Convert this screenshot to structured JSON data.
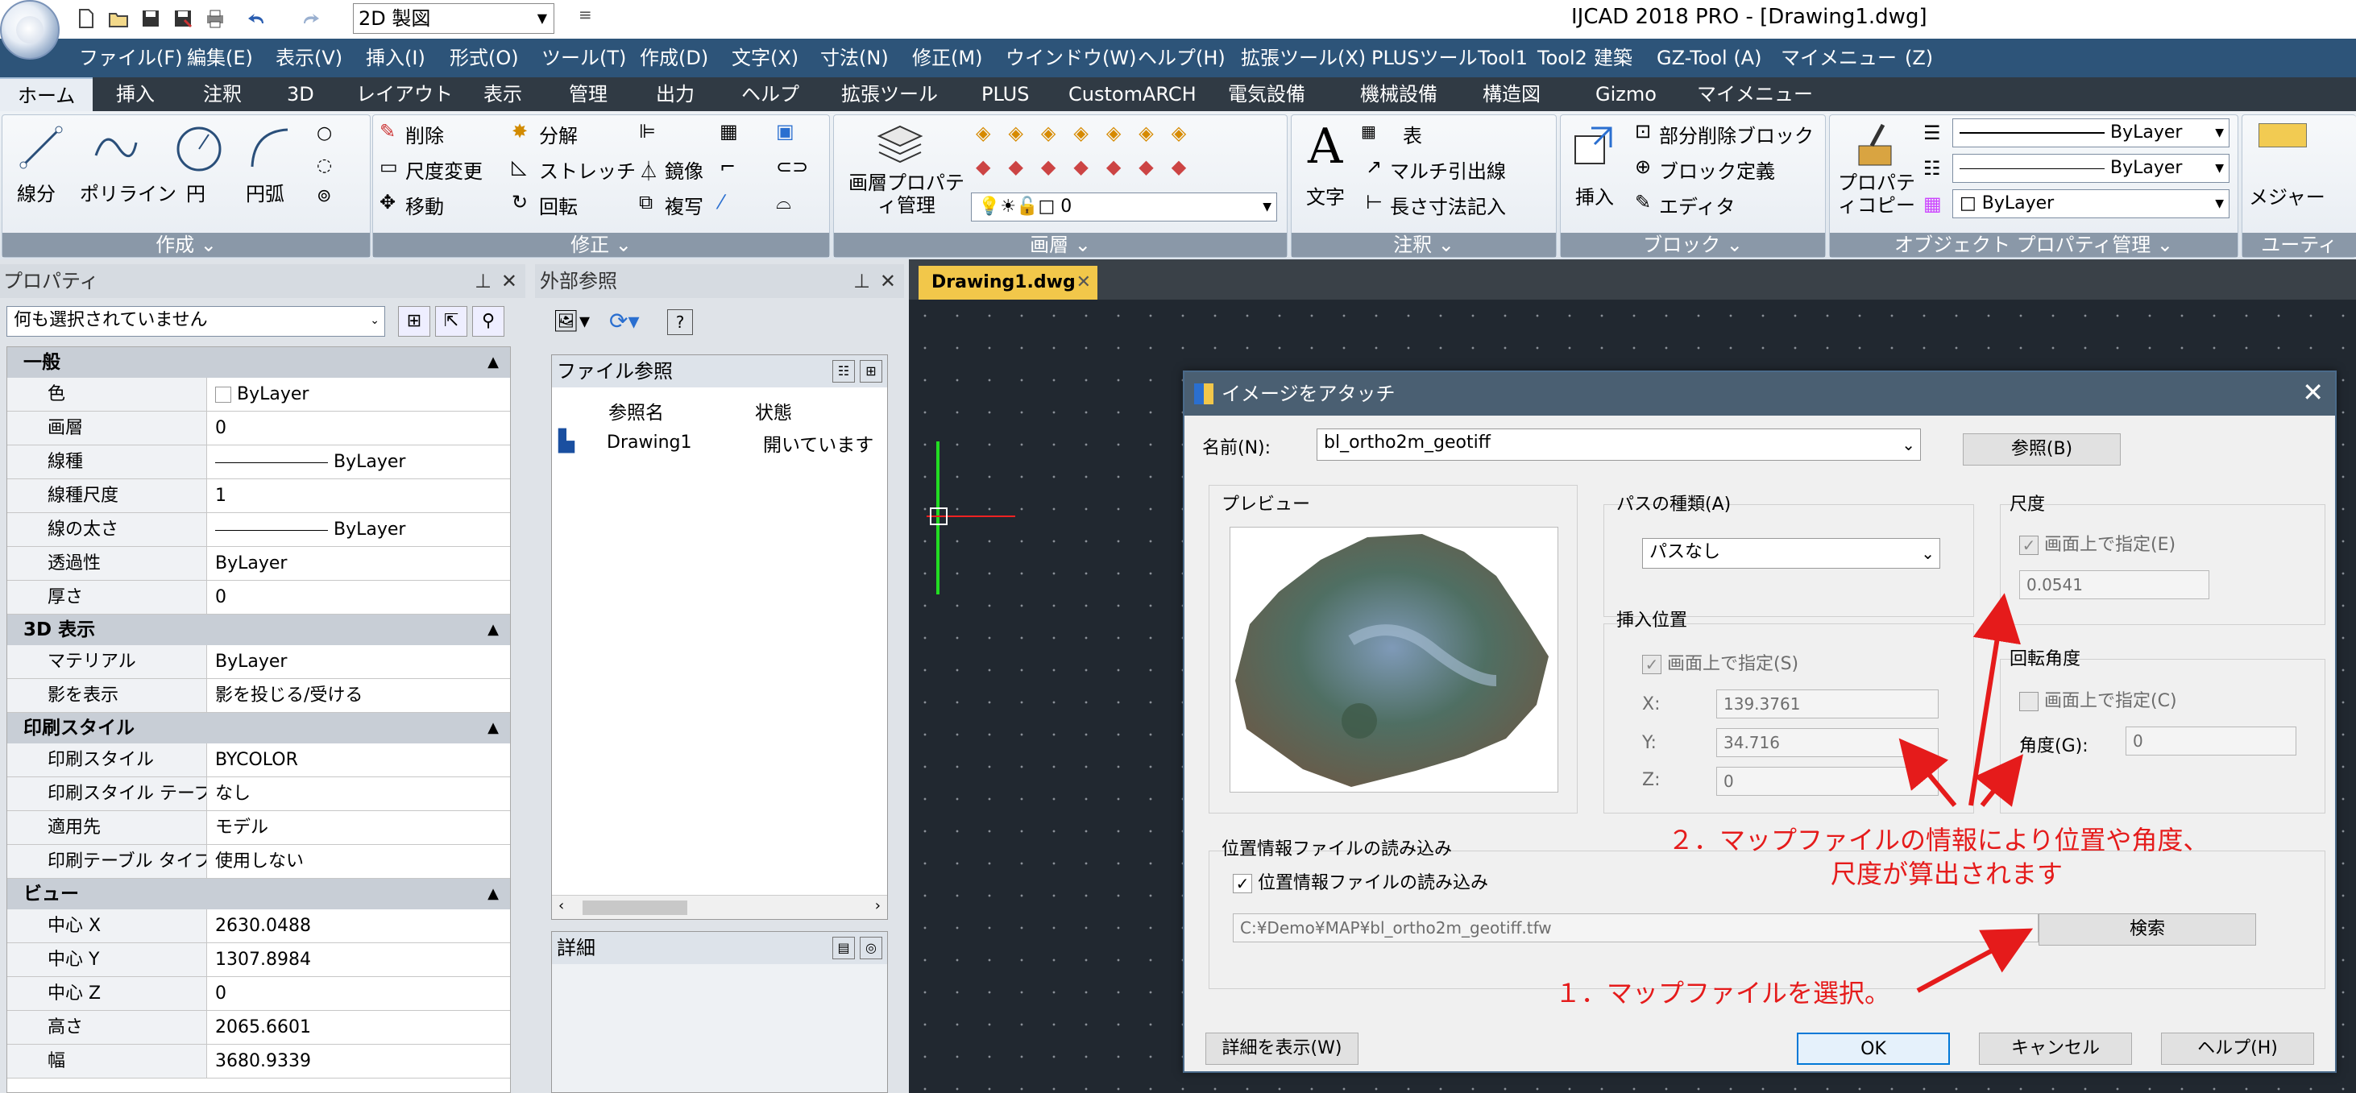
{
  "app": {
    "title": "IJCAD 2018 PRO - [Drawing1.dwg]",
    "workspace": "2D 製図"
  },
  "menu": [
    "ファイル(F)",
    "編集(E)",
    "表示(V)",
    "挿入(I)",
    "形式(O)",
    "ツール(T)",
    "作成(D)",
    "文字(X)",
    "寸法(N)",
    "修正(M)",
    "ウインドウ(W)",
    "ヘルプ(H)",
    "拡張ツール(X)",
    "PLUSツール",
    "Tool1",
    "Tool2",
    "建築",
    "GZ-Tool (A)",
    "マイメニュー",
    "(Z)"
  ],
  "ribbon_tabs": [
    "ホーム",
    "挿入",
    "注釈",
    "3D",
    "レイアウト",
    "表示",
    "管理",
    "出力",
    "ヘルプ",
    "拡張ツール",
    "PLUS",
    "CustomARCH",
    "電気設備",
    "機械設備",
    "構造図",
    "Gizmo",
    "マイメニュー"
  ],
  "ribbon": {
    "draw": {
      "title": "作成",
      "tools": [
        "線分",
        "ポリライン",
        "円",
        "円弧"
      ]
    },
    "modify": {
      "title": "修正",
      "tools": [
        "削除",
        "分解",
        "尺度変更",
        "ストレッチ",
        "鏡像",
        "移動",
        "回転",
        "複写"
      ]
    },
    "layer": {
      "title": "画層",
      "big": "画層プロパティ管理",
      "combo": "0"
    },
    "annot": {
      "title": "注釈",
      "big": "文字",
      "tools": [
        "表",
        "マルチ引出線",
        "長さ寸法記入"
      ]
    },
    "block": {
      "title": "ブロック",
      "big": "挿入",
      "tools": [
        "部分削除ブロック",
        "ブロック定義",
        "エディタ"
      ]
    },
    "props": {
      "title": "オブジェクト プロパティ管理",
      "big": "プロパティコピー",
      "c1": "ByLayer",
      "c2": "ByLayer",
      "c3": "ByLayer"
    },
    "util": {
      "title": "ユーティ",
      "big": "メジャー"
    }
  },
  "properties": {
    "title": "プロパティ",
    "selection": "何も選択されていません",
    "sections": [
      {
        "name": "一般",
        "rows": [
          [
            "色",
            "ByLayer"
          ],
          [
            "画層",
            "0"
          ],
          [
            "線種",
            "ByLayer"
          ],
          [
            "線種尺度",
            "1"
          ],
          [
            "線の太さ",
            "ByLayer"
          ],
          [
            "透過性",
            "ByLayer"
          ],
          [
            "厚さ",
            "0"
          ]
        ]
      },
      {
        "name": "3D 表示",
        "rows": [
          [
            "マテリアル",
            "ByLayer"
          ],
          [
            "影を表示",
            "影を投じる/受ける"
          ]
        ]
      },
      {
        "name": "印刷スタイル",
        "rows": [
          [
            "印刷スタイル",
            "BYCOLOR"
          ],
          [
            "印刷スタイル テーブル",
            "なし"
          ],
          [
            "適用先",
            "モデル"
          ],
          [
            "印刷テーブル タイプ",
            "使用しない"
          ]
        ]
      },
      {
        "name": "ビュー",
        "rows": [
          [
            "中心 X",
            "2630.0488"
          ],
          [
            "中心 Y",
            "1307.8984"
          ],
          [
            "中心 Z",
            "0"
          ],
          [
            "高さ",
            "2065.6601"
          ],
          [
            "幅",
            "3680.9339"
          ]
        ]
      }
    ]
  },
  "xref": {
    "title": "外部参照",
    "section": "ファイル参照",
    "col_name": "参照名",
    "col_status": "状態",
    "item_name": "Drawing1",
    "item_status": "開いています",
    "details": "詳細"
  },
  "doc_tab": "Drawing1.dwg",
  "dialog": {
    "title": "イメージをアタッチ",
    "name_label": "名前(N):",
    "name_value": "bl_ortho2m_geotiff",
    "browse": "参照(B)",
    "preview": "プレビュー",
    "path_type": "パスの種類(A)",
    "path_value": "パスなし",
    "insert": "挿入位置",
    "insert_onscreen": "画面上で指定(S)",
    "x_label": "X:",
    "x": "139.3761",
    "y_label": "Y:",
    "y": "34.716",
    "z_label": "Z:",
    "z": "0",
    "scale": "尺度",
    "scale_onscreen": "画面上で指定(E)",
    "scale_value": "0.0541",
    "rotation": "回転角度",
    "rotation_onscreen": "画面上で指定(C)",
    "angle_label": "角度(G):",
    "angle_value": "0",
    "geo": "位置情報ファイルの読み込み",
    "geo_check": "位置情報ファイルの読み込み",
    "geo_path": "C:¥Demo¥MAP¥bl_ortho2m_geotiff.tfw",
    "search": "検索",
    "details": "詳細を表示(W)",
    "ok": "OK",
    "cancel": "キャンセル",
    "help": "ヘルプ(H)"
  },
  "annotations": {
    "a1": "１．マップファイルを選択。",
    "a2_line1": "２．マップファイルの情報により位置や角度、",
    "a2_line2": "尺度が算出されます"
  },
  "colors": {
    "menubar": "#2d5479",
    "annot": "#e51b1b",
    "dialog_title": "#4a5f72"
  }
}
